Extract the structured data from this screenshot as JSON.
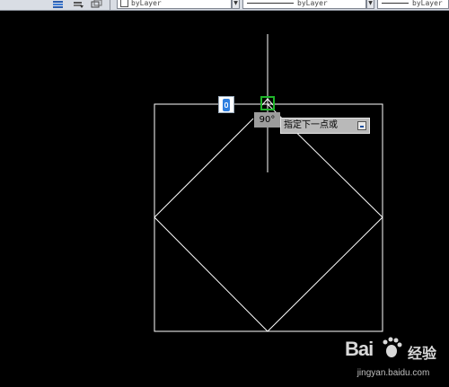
{
  "toolbar": {
    "color_combo": "byLayer",
    "linetype_combo": "byLayer",
    "lineweight_combo": "byLayer",
    "icons": [
      "layer-properties-icon",
      "layer-state-icon",
      "layer-previous-icon"
    ]
  },
  "drawing": {
    "background": "#000000",
    "line_color": "#ffffff",
    "crosshair_color": "#ffffff",
    "snap_marker_color": "#1fb52a"
  },
  "dynamic_input": {
    "angle": "90°",
    "prompt": "指定下一点或",
    "options_icon": "dropdown-options-icon"
  },
  "watermark": {
    "brand_a": "Bai",
    "brand_b": "经验",
    "url": "jingyan.baidu.com"
  }
}
